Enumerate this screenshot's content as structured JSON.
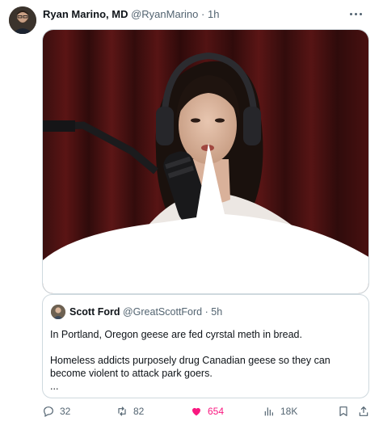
{
  "author": {
    "name": "Ryan Marino, MD",
    "handle": "@RyanMarino",
    "separator": "·",
    "time": "1h"
  },
  "quoted_tweet": {
    "name": "Scott Ford",
    "handle": "@GreatScottFord",
    "separator": "·",
    "time": "5h",
    "lines": [
      "In Portland, Oregon geese are fed cyrstal meth in bread.",
      "Homeless addicts purposely drug Canadian geese so they can become violent to attack park goers.",
      "..."
    ]
  },
  "actions": {
    "replies": "32",
    "retweets": "82",
    "likes": "654",
    "views": "18K"
  },
  "colors": {
    "like_active": "#f91880",
    "muted_text": "#536471",
    "border": "#cfd9de"
  },
  "icons": {
    "more": "more-dots-icon",
    "reply": "reply-icon",
    "retweet": "retweet-icon",
    "like": "heart-icon",
    "views": "views-icon",
    "bookmark": "bookmark-icon",
    "share": "share-icon"
  }
}
